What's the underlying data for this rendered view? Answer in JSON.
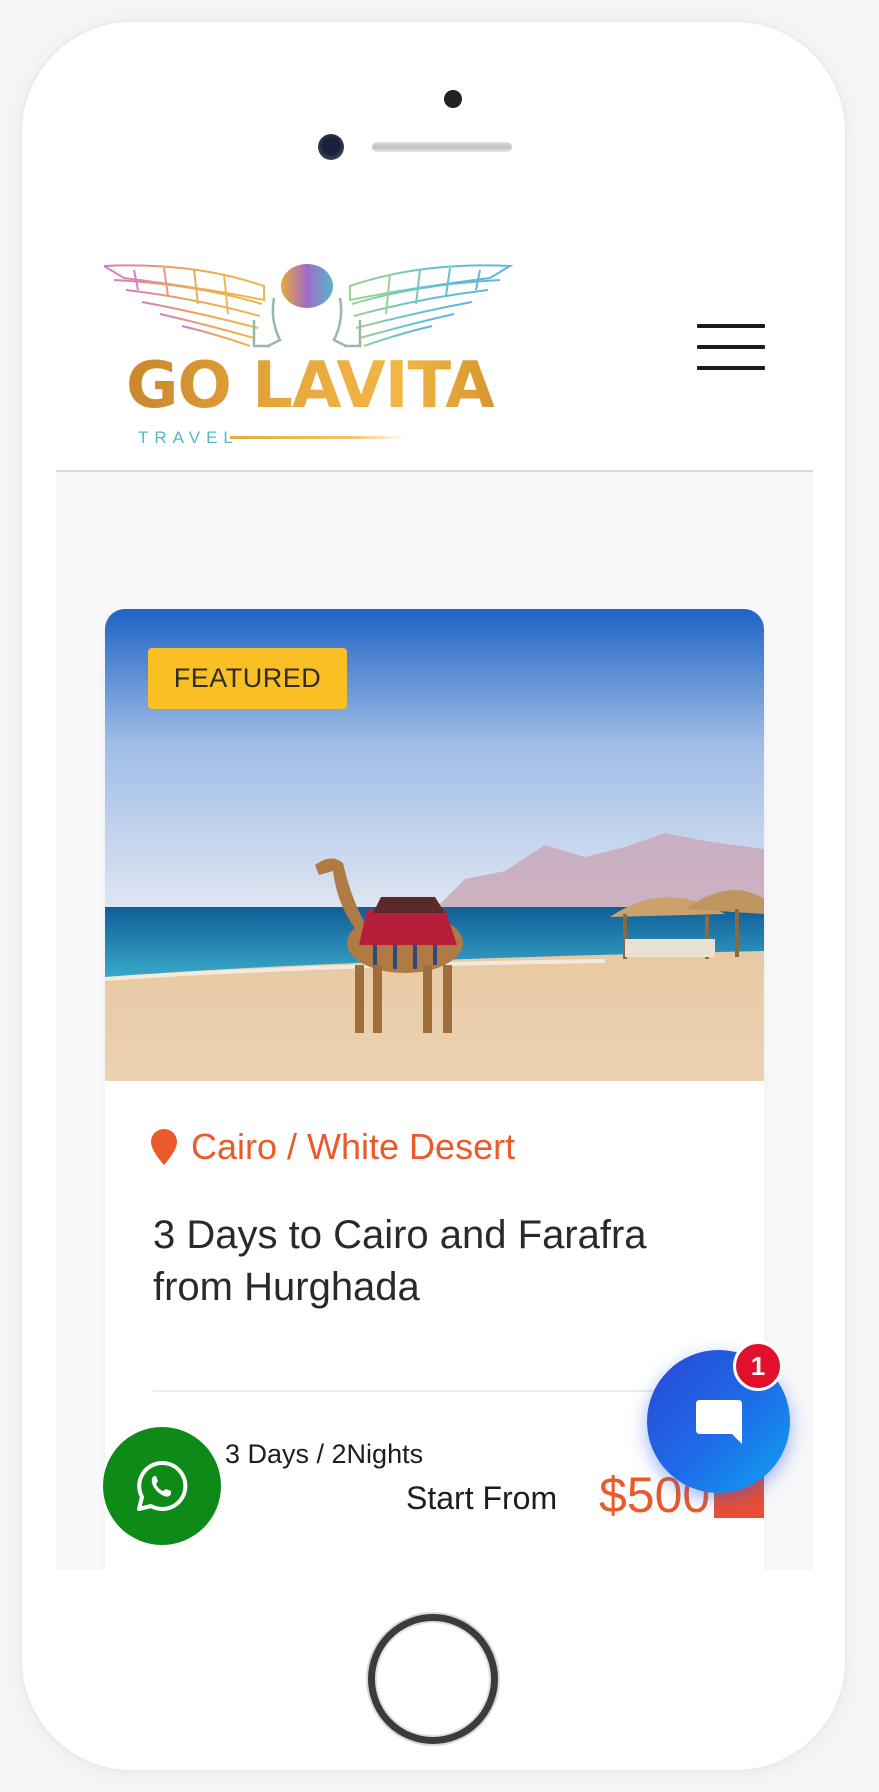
{
  "brand": {
    "name": "GO LAVITA",
    "tagline": "TRAVEL"
  },
  "header": {
    "menu_icon": "hamburger-icon"
  },
  "tour": {
    "badge": "FEATURED",
    "location": "Cairo / White Desert",
    "title": "3 Days to Cairo and Farafra from Hurghada",
    "duration": "3 Days / 2Nights",
    "price_label": "Start From",
    "price": "$500",
    "image_icon": "camel-beach-photo"
  },
  "floating": {
    "whatsapp_icon": "whatsapp-icon",
    "chat_icon": "chat-bubble-icon",
    "chat_unread": "1"
  },
  "colors": {
    "accent": "#ea5a2a",
    "badge": "#f9bf24",
    "whatsapp": "#0d8a17",
    "chat": "#1e6de8",
    "notification": "#e0102e"
  }
}
